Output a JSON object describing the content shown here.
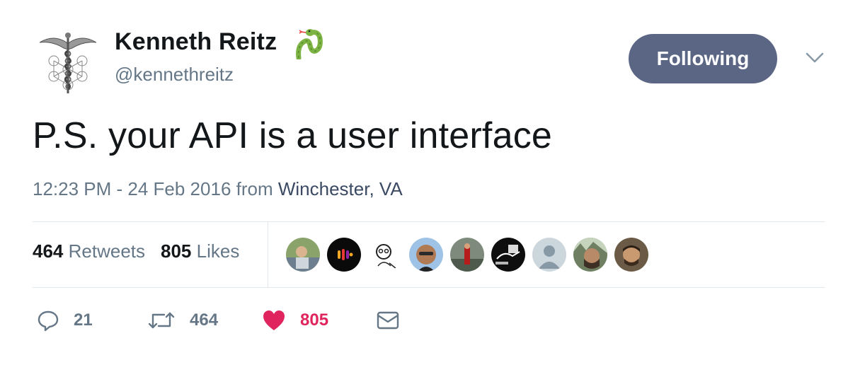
{
  "author": {
    "name": "Kenneth Reitz",
    "handle": "@kennethreitz",
    "emoji": "snake-emoji"
  },
  "follow_button": {
    "label": "Following"
  },
  "tweet": {
    "text": "P.S. your API is a user interface",
    "timestamp": "12:23 PM - 24 Feb 2016 from ",
    "location": "Winchester, VA"
  },
  "stats": {
    "retweets_count": "464",
    "retweets_label": "Retweets",
    "likes_count": "805",
    "likes_label": "Likes"
  },
  "likers": [
    {
      "icon": "liker-avatar-1"
    },
    {
      "icon": "liker-avatar-2"
    },
    {
      "icon": "liker-avatar-3"
    },
    {
      "icon": "liker-avatar-4"
    },
    {
      "icon": "liker-avatar-5"
    },
    {
      "icon": "liker-avatar-6"
    },
    {
      "icon": "liker-avatar-7"
    },
    {
      "icon": "liker-avatar-8"
    },
    {
      "icon": "liker-avatar-9"
    }
  ],
  "actions": {
    "reply_count": "21",
    "retweet_count": "464",
    "like_count": "805"
  },
  "colors": {
    "follow_button": "#5b6584",
    "like": "#e0245e",
    "muted": "#657786"
  }
}
